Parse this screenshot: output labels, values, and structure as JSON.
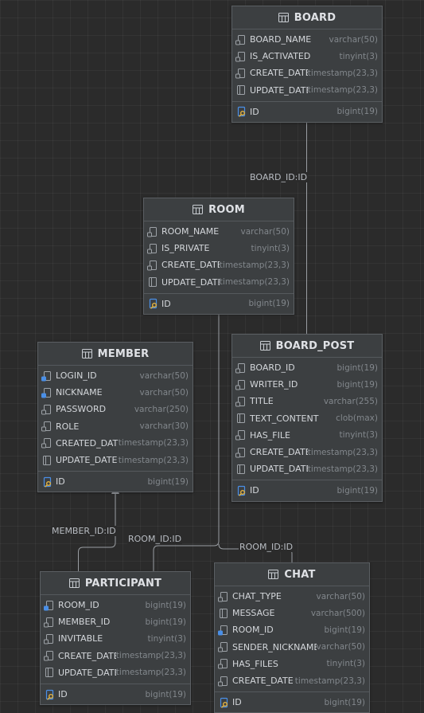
{
  "colors": {
    "background": "#2b2b2b",
    "table_bg": "#3c3f41",
    "edge": "#9a9ea3",
    "index_icon": "#4a8fe7",
    "key_icon": "#e3b341"
  },
  "tables": {
    "board": {
      "name": "BOARD",
      "columns": [
        {
          "name": "BOARD_NAME",
          "type": "varchar(50)",
          "icon": "index-column-icon"
        },
        {
          "name": "IS_ACTIVATED",
          "type": "tinyint(3)",
          "icon": "index-column-icon"
        },
        {
          "name": "CREATE_DATE",
          "type": "timestamp(23,3)",
          "icon": "index-column-icon"
        },
        {
          "name": "UPDATE_DATE",
          "type": "timestamp(23,3)",
          "icon": "column-icon"
        }
      ],
      "pk": {
        "name": "ID",
        "type": "bigint(19)",
        "icon": "primary-key-icon"
      }
    },
    "room": {
      "name": "ROOM",
      "columns": [
        {
          "name": "ROOM_NAME",
          "type": "varchar(50)",
          "icon": "index-column-icon"
        },
        {
          "name": "IS_PRIVATE",
          "type": "tinyint(3)",
          "icon": "index-column-icon"
        },
        {
          "name": "CREATE_DATE",
          "type": "timestamp(23,3)",
          "icon": "index-column-icon"
        },
        {
          "name": "UPDATE_DATE",
          "type": "timestamp(23,3)",
          "icon": "column-icon"
        }
      ],
      "pk": {
        "name": "ID",
        "type": "bigint(19)",
        "icon": "primary-key-icon"
      }
    },
    "member": {
      "name": "MEMBER",
      "columns": [
        {
          "name": "LOGIN_ID",
          "type": "varchar(50)",
          "icon": "unique-index-column-icon"
        },
        {
          "name": "NICKNAME",
          "type": "varchar(50)",
          "icon": "unique-index-column-icon"
        },
        {
          "name": "PASSWORD",
          "type": "varchar(250)",
          "icon": "index-column-icon"
        },
        {
          "name": "ROLE",
          "type": "varchar(30)",
          "icon": "index-column-icon"
        },
        {
          "name": "CREATED_DATE",
          "type": "timestamp(23,3)",
          "icon": "index-column-icon"
        },
        {
          "name": "UPDATE_DATE",
          "type": "timestamp(23,3)",
          "icon": "column-icon"
        }
      ],
      "pk": {
        "name": "ID",
        "type": "bigint(19)",
        "icon": "primary-key-icon"
      }
    },
    "board_post": {
      "name": "BOARD_POST",
      "columns": [
        {
          "name": "BOARD_ID",
          "type": "bigint(19)",
          "icon": "index-column-icon"
        },
        {
          "name": "WRITER_ID",
          "type": "bigint(19)",
          "icon": "index-column-icon"
        },
        {
          "name": "TITLE",
          "type": "varchar(255)",
          "icon": "index-column-icon"
        },
        {
          "name": "TEXT_CONTENT",
          "type": "clob(max)",
          "icon": "column-icon"
        },
        {
          "name": "HAS_FILE",
          "type": "tinyint(3)",
          "icon": "index-column-icon"
        },
        {
          "name": "CREATE_DATE",
          "type": "timestamp(23,3)",
          "icon": "index-column-icon"
        },
        {
          "name": "UPDATE_DATE",
          "type": "timestamp(23,3)",
          "icon": "column-icon"
        }
      ],
      "pk": {
        "name": "ID",
        "type": "bigint(19)",
        "icon": "primary-key-icon"
      }
    },
    "participant": {
      "name": "PARTICIPANT",
      "columns": [
        {
          "name": "ROOM_ID",
          "type": "bigint(19)",
          "icon": "foreign-key-column-icon"
        },
        {
          "name": "MEMBER_ID",
          "type": "bigint(19)",
          "icon": "index-column-icon"
        },
        {
          "name": "INVITABLE",
          "type": "tinyint(3)",
          "icon": "index-column-icon"
        },
        {
          "name": "CREATE_DATE",
          "type": "timestamp(23,3)",
          "icon": "index-column-icon"
        },
        {
          "name": "UPDATE_DATE",
          "type": "timestamp(23,3)",
          "icon": "column-icon"
        }
      ],
      "pk": {
        "name": "ID",
        "type": "bigint(19)",
        "icon": "primary-key-icon"
      }
    },
    "chat": {
      "name": "CHAT",
      "columns": [
        {
          "name": "CHAT_TYPE",
          "type": "varchar(50)",
          "icon": "index-column-icon"
        },
        {
          "name": "MESSAGE",
          "type": "varchar(500)",
          "icon": "column-icon"
        },
        {
          "name": "ROOM_ID",
          "type": "bigint(19)",
          "icon": "foreign-key-column-icon"
        },
        {
          "name": "SENDER_NICKNAME",
          "type": "varchar(50)",
          "icon": "index-column-icon"
        },
        {
          "name": "HAS_FILES",
          "type": "tinyint(3)",
          "icon": "index-column-icon"
        },
        {
          "name": "CREATE_DATE",
          "type": "timestamp(23,3)",
          "icon": "index-column-icon"
        }
      ],
      "pk": {
        "name": "ID",
        "type": "bigint(19)",
        "icon": "primary-key-icon"
      }
    }
  },
  "relations": {
    "board_post_board": "BOARD_ID:ID",
    "participant_member": "MEMBER_ID:ID",
    "participant_room": "ROOM_ID:ID",
    "chat_room": "ROOM_ID:ID"
  }
}
